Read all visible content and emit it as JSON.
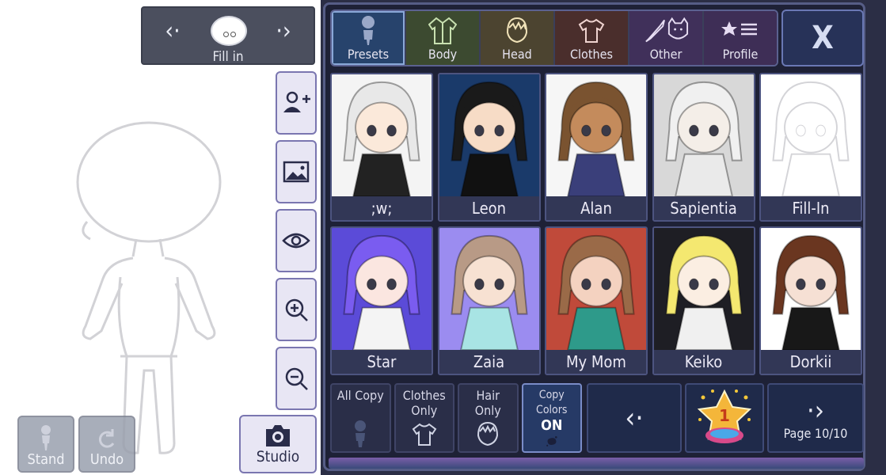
{
  "selector": {
    "name": "Fill in",
    "prev_icon": "chevron-left",
    "next_icon": "chevron-right"
  },
  "side_buttons": [
    "add-character-icon",
    "image-icon",
    "eye-icon",
    "zoom-in-icon",
    "zoom-out-icon"
  ],
  "bottom_buttons": {
    "stand": "Stand",
    "undo": "Undo",
    "studio": "Studio"
  },
  "tabs": [
    {
      "label": "Presets",
      "icon": "person-icon"
    },
    {
      "label": "Body",
      "icon": "jacket-icon"
    },
    {
      "label": "Head",
      "icon": "hair-icon"
    },
    {
      "label": "Clothes",
      "icon": "shirt-icon"
    },
    {
      "label": "Other",
      "icon": "sword-cat-icon"
    },
    {
      "label": "Profile",
      "icon": "star-list-icon"
    }
  ],
  "close_label": "X",
  "presets": [
    {
      "name": ";w;",
      "bg": "#f4f4f4",
      "hair": "#e8e8e8",
      "skin": "#fbe9da",
      "outfit": "#222222"
    },
    {
      "name": "Leon",
      "bg": "#1a3a6a",
      "hair": "#1a1a1a",
      "skin": "#f7dcc6",
      "outfit": "#111111"
    },
    {
      "name": "Alan",
      "bg": "#f6f6f6",
      "hair": "#7a5330",
      "skin": "#c48b5c",
      "outfit": "#3a3f7a"
    },
    {
      "name": "Sapientia",
      "bg": "#d8d8d8",
      "hair": "#f0f0f0",
      "skin": "#f4eee8",
      "outfit": "#eaeaea"
    },
    {
      "name": "Fill-In",
      "bg": "#ffffff",
      "hair": "#ffffff",
      "skin": "#ffffff",
      "outfit": "#ffffff"
    },
    {
      "name": "Star",
      "bg": "#5b4bd8",
      "hair": "#7a5cf0",
      "skin": "#fbe6e0",
      "outfit": "#f4f4f4"
    },
    {
      "name": "Zaia",
      "bg": "#9b8cf0",
      "hair": "#b89a86",
      "skin": "#f7e1d2",
      "outfit": "#a8e4e4"
    },
    {
      "name": "My Mom",
      "bg": "#c04a3a",
      "hair": "#9a6a48",
      "skin": "#f4d2c0",
      "outfit": "#2e9a8a"
    },
    {
      "name": "Keiko",
      "bg": "#1e1e24",
      "hair": "#f4e870",
      "skin": "#fbeee2",
      "outfit": "#f0f0f0"
    },
    {
      "name": "Dorkii",
      "bg": "#ffffff",
      "hair": "#6a3620",
      "skin": "#f6e0d4",
      "outfit": "#181818"
    }
  ],
  "copy_options": [
    {
      "line1": "All Copy",
      "line2": "",
      "icon": "person-icon"
    },
    {
      "line1": "Clothes",
      "line2": "Only",
      "icon": "shirt-icon"
    },
    {
      "line1": "Hair",
      "line2": "Only",
      "icon": "hair-icon"
    },
    {
      "line1": "Copy Colors",
      "line2": "ON",
      "icon": "paint-splat-icon"
    }
  ],
  "navigation": {
    "prev_icon": "chevron-left",
    "next_icon": "chevron-right",
    "page_label": "Page 10/10",
    "star_badge": "1"
  }
}
